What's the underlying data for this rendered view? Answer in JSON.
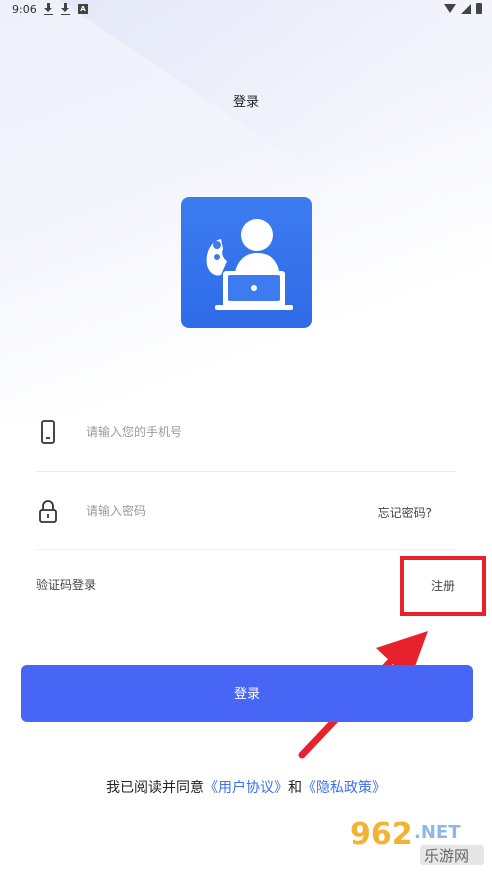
{
  "status_bar": {
    "time": "9:06",
    "badge": "A"
  },
  "page": {
    "title": "登录"
  },
  "form": {
    "phone_placeholder": "请输入您的手机号",
    "password_placeholder": "请输入密码",
    "forgot_password": "忘记密码?",
    "sms_login": "验证码登录",
    "register": "注册"
  },
  "login_button": "登录",
  "agreement": {
    "prefix": "我已阅读并同意",
    "user_agreement": "《用户协议》",
    "and": "和",
    "privacy_policy": "《隐私政策》"
  },
  "watermark": {
    "number": "962",
    "suffix": ".NET",
    "sub": "乐游网"
  },
  "colors": {
    "primary": "#4866f5",
    "link": "#3e6ff0",
    "highlight": "#e8222d",
    "logo": "#3c7cf0"
  }
}
